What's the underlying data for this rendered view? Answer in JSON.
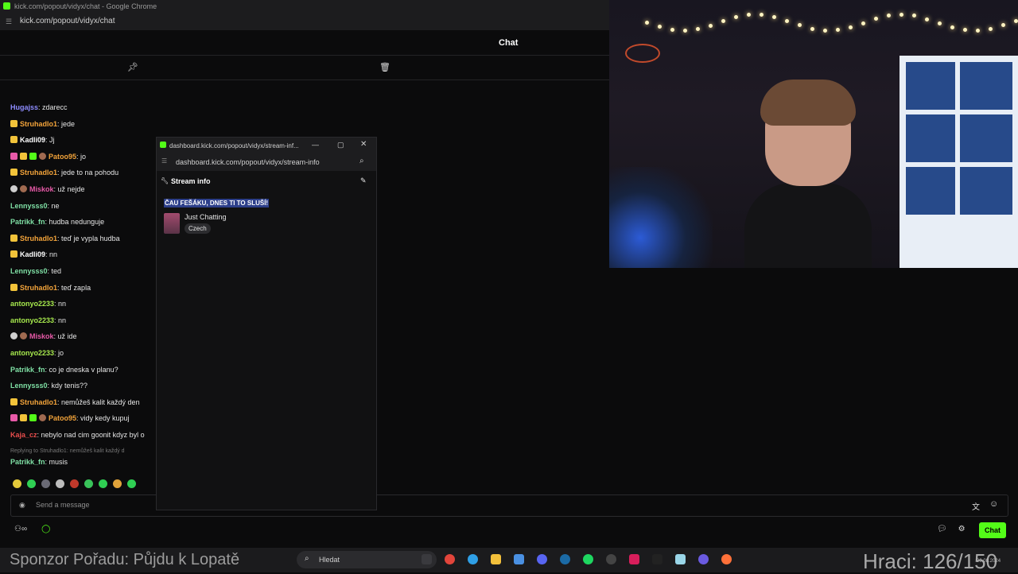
{
  "browser": {
    "window_title": "kick.com/popout/vidyx/chat - Google Chrome",
    "url": "kick.com/popout/vidyx/chat"
  },
  "chat": {
    "header_title": "Chat",
    "pin_icon": "pin-icon",
    "trash_icon": "trash-icon",
    "messages": [
      {
        "user": "Hugajss",
        "color": "#8e8cff",
        "text": ": zdarecc",
        "badges": []
      },
      {
        "user": "Struhadlo1",
        "color": "#f2a33a",
        "text": ": jede",
        "badges": [
          "sub"
        ]
      },
      {
        "user": "Kadli09",
        "color": "#ffffff",
        "text": ": Jj",
        "badges": [
          "sub"
        ]
      },
      {
        "user": "Patoo95",
        "color": "#f2a33a",
        "text": ": jo",
        "badges": [
          "mod",
          "vip",
          "gift",
          "avatar"
        ]
      },
      {
        "user": "Struhadlo1",
        "color": "#f2a33a",
        "text": ": jede to na pohodu",
        "badges": [
          "sub"
        ]
      },
      {
        "user": "Miskok",
        "color": "#e85aa8",
        "text": ": už nejde",
        "badges": [
          "og",
          "avatar"
        ]
      },
      {
        "user": "Lennysss0",
        "color": "#7fe0a5",
        "text": ": ne",
        "badges": []
      },
      {
        "user": "Patrikk_fn",
        "color": "#7fe0a5",
        "text": ": hudba nedunguje",
        "badges": []
      },
      {
        "user": "Struhadlo1",
        "color": "#f2a33a",
        "text": ": teď je vypla hudba",
        "badges": [
          "sub"
        ]
      },
      {
        "user": "Kadli09",
        "color": "#ffffff",
        "text": ": nn",
        "badges": [
          "sub"
        ]
      },
      {
        "user": "Lennysss0",
        "color": "#7fe0a5",
        "text": ": ted",
        "badges": []
      },
      {
        "user": "Struhadlo1",
        "color": "#f2a33a",
        "text": ": teď zapla",
        "badges": [
          "sub"
        ]
      },
      {
        "user": "antonyo2233",
        "color": "#a6e84d",
        "text": ": nn",
        "badges": []
      },
      {
        "user": "antonyo2233",
        "color": "#a6e84d",
        "text": ": nn",
        "badges": []
      },
      {
        "user": "Miskok",
        "color": "#e85aa8",
        "text": ": už ide",
        "badges": [
          "og",
          "avatar"
        ]
      },
      {
        "user": "antonyo2233",
        "color": "#a6e84d",
        "text": ": jo",
        "badges": []
      },
      {
        "user": "Patrikk_fn",
        "color": "#7fe0a5",
        "text": ": co je dneska v planu?",
        "badges": []
      },
      {
        "user": "Lennysss0",
        "color": "#7fe0a5",
        "text": ": kdy tenis??",
        "badges": []
      },
      {
        "user": "Struhadlo1",
        "color": "#f2a33a",
        "text": ": nemůžeš kalit každý den",
        "badges": [
          "sub"
        ]
      },
      {
        "user": "Patoo95",
        "color": "#f2a33a",
        "text": ": vidy kedy kupuj",
        "badges": [
          "mod",
          "vip",
          "gift",
          "avatar"
        ]
      },
      {
        "user": "Kaja_cz",
        "color": "#e84d4d",
        "text": ": nebylo nad cim goonit kdyz byl o",
        "badges": []
      }
    ],
    "reply_note": "Replying to Struhadlo1: nemůžeš kalit každý d",
    "last_message": {
      "user": "Patrikk_fn",
      "color": "#7fe0a5",
      "text": ": musis"
    },
    "input_placeholder": "Send a message",
    "send_button": "Chat"
  },
  "popup": {
    "window_title": "dashboard.kick.com/popout/vidyx/stream-inf...",
    "url": "dashboard.kick.com/popout/vidyx/stream-info",
    "section_label": "Stream info",
    "stream_title": "ČAU FEŠÁKU, DNES TI TO SLUŠÍ!",
    "category": "Just Chatting",
    "language": "Czech"
  },
  "taskbar": {
    "sponsor_text": "Sponzor Pořadu: Půjdu k Lopatě",
    "search_placeholder": "Hledat",
    "hraci_text": "Hraci: 126/150",
    "clock": "20.08.2024"
  },
  "colors": {
    "kick_green": "#53fc18",
    "background": "#0b0b0c",
    "panel": "#111112"
  }
}
